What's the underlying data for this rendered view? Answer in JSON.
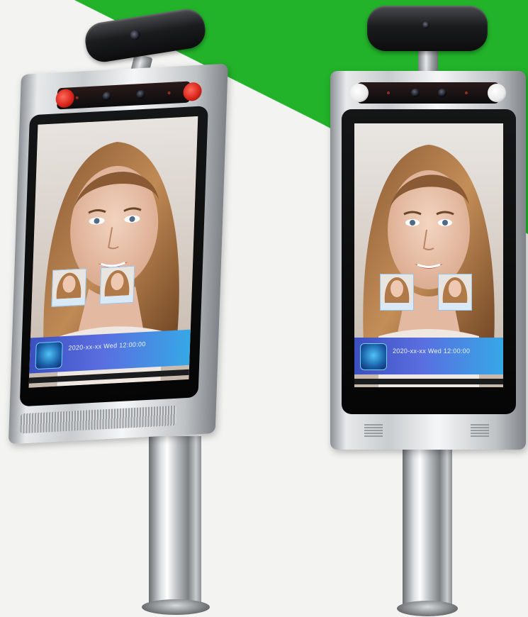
{
  "scene": {
    "colors": {
      "background": "#f3f3f2",
      "green_accent": "#22b32a",
      "ir_red": "#d9261c",
      "ir_white": "#f7f7f7",
      "banner_blue": "#4a5fd6"
    },
    "devices": [
      {
        "name": "left-terminal",
        "banner": {
          "text": "2020-xx-xx  Wed  12:00:00"
        },
        "ir_light_color": "red"
      },
      {
        "name": "right-terminal",
        "banner": {
          "text": "2020-xx-xx  Wed  12:00:00"
        },
        "ir_light_color": "white"
      }
    ]
  }
}
